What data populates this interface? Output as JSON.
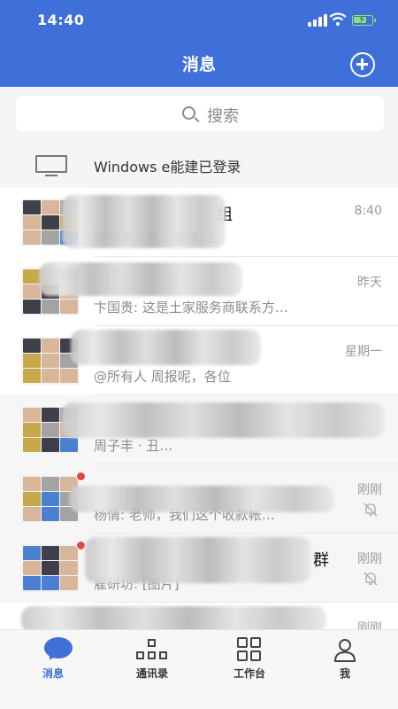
{
  "status": {
    "time": "14:40"
  },
  "header": {
    "title": "消息",
    "add_icon": "plus-circle-icon"
  },
  "search": {
    "label": "搜索",
    "icon": "search-icon"
  },
  "login_notice": {
    "text": "Windows e能建已登录",
    "icon": "monitor-icon"
  },
  "chats": [
    {
      "name": "组",
      "preview": "周子丰 · 丑…零员: 1",
      "time": "8:40",
      "muted": false,
      "unread": false
    },
    {
      "name": "",
      "preview": "卞国贵: 这是土家服务商联系方…",
      "time": "昨天",
      "muted": false,
      "unread": false
    },
    {
      "name": "",
      "preview": "@所有人 周报呢，各位",
      "time": "星期一",
      "muted": false,
      "unread": false
    },
    {
      "name": "",
      "preview": "周子丰 · 丑…",
      "time": "",
      "muted": false,
      "unread": false
    },
    {
      "name": "",
      "preview": "杨情: 老师，我们这个收款帐…",
      "time": "刚刚",
      "muted": true,
      "unread": true
    },
    {
      "name": "群",
      "preview": "雇研坊: [图片]",
      "time": "刚刚",
      "muted": true,
      "unread": true
    },
    {
      "name": "",
      "preview": "",
      "time": "刚刚",
      "muted": false,
      "unread": false
    }
  ],
  "tabs": [
    {
      "label": "消息",
      "icon": "message-icon",
      "active": true
    },
    {
      "label": "通讯录",
      "icon": "contacts-icon",
      "active": false
    },
    {
      "label": "工作台",
      "icon": "workbench-icon",
      "active": false
    },
    {
      "label": "我",
      "icon": "profile-icon",
      "active": false
    }
  ],
  "colors": {
    "primary": "#3f6fd9",
    "badge": "#e5463f"
  }
}
